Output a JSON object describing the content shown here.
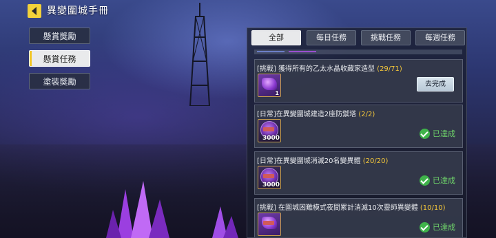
{
  "header": {
    "title": "異變圍城手冊"
  },
  "menu": [
    {
      "label": "懸賞獎勵",
      "active": false
    },
    {
      "label": "懸賞任務",
      "active": true
    },
    {
      "label": "塗裝獎勵",
      "active": false
    }
  ],
  "tabs": [
    {
      "label": "全部",
      "active": true
    },
    {
      "label": "每日任務",
      "active": false
    },
    {
      "label": "挑戰任務",
      "active": false
    },
    {
      "label": "每週任務",
      "active": false
    }
  ],
  "missions": [
    {
      "prefix": "[挑戰]",
      "name": " 獲得所有的乙太水晶收藏家造型 ",
      "progress": "(29/71)",
      "reward_qty": "1",
      "action": "去完成"
    },
    {
      "prefix": "[日常]",
      "name": "在異變圍城建造2座防禦塔 ",
      "progress": "(2/2)",
      "reward_qty": "3000",
      "status": "已達成"
    },
    {
      "prefix": "[日常]",
      "name": "在異變圍城消滅20名變異體 ",
      "progress": "(20/20)",
      "reward_qty": "3000",
      "status": "已達成"
    },
    {
      "prefix": "[挑戰]",
      "name": " 在圍城困難模式夜間累計消滅10次靈師異變體 ",
      "progress": "(10/10)",
      "reward_qty": "",
      "status": "已達成"
    }
  ],
  "colors": {
    "accent": "#f2c623",
    "progress": "#f5c83a",
    "done": "#3fb34a"
  }
}
